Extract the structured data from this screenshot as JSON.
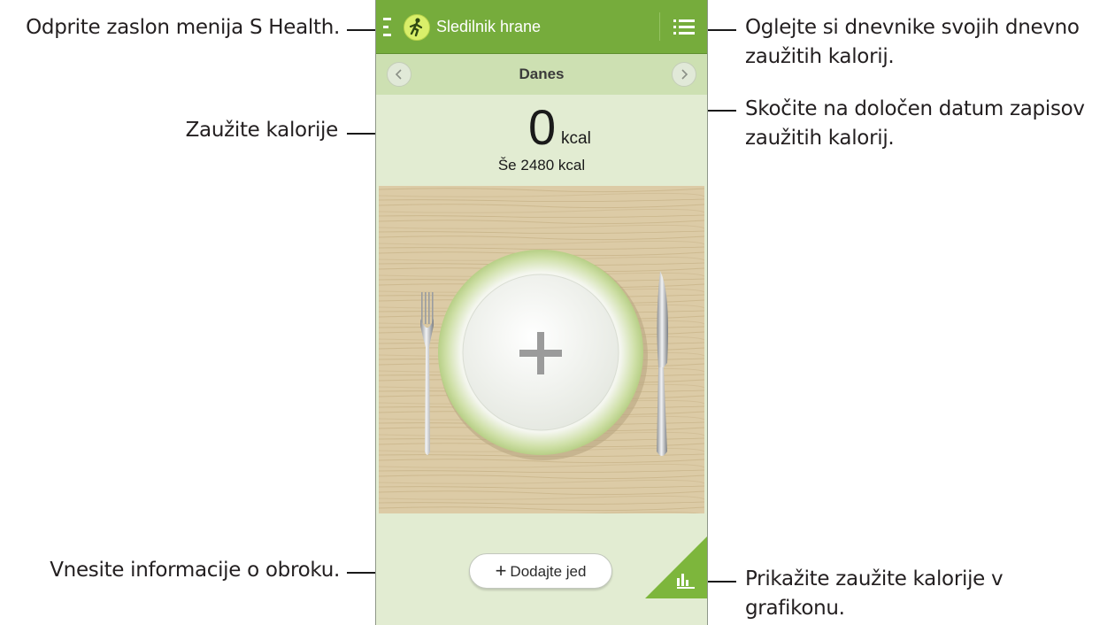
{
  "app": {
    "title": "Sledilnik hrane"
  },
  "datebar": {
    "label": "Danes"
  },
  "calories": {
    "value": "0",
    "unit": "kcal",
    "remaining": "Še 2480 kcal"
  },
  "actions": {
    "add_meal_plus": "+",
    "add_meal_label": "Dodajte jed"
  },
  "callouts": {
    "menu": "Odprite zaslon menija S Health.",
    "consumed": "Zaužite kalorije",
    "meal_info": "Vnesite informacije o obroku.",
    "logs_line1": "Oglejte si dnevnike svojih dnevno",
    "logs_line2": "zaužitih kalorij.",
    "date_line1": "Skočite na določen datum zapisov",
    "date_line2": "zaužitih kalorij.",
    "graph_line1": "Prikažite zaužite kalorije v",
    "graph_line2": "grafikonu."
  },
  "colors": {
    "actionbar": "#76ac3c",
    "datebar": "#cde0b2",
    "background": "#e2ecd2",
    "accent": "#7db63c",
    "table": "#d9c8a4"
  },
  "icons": {
    "menu": "menu-icon",
    "logo": "runner-logo-icon",
    "logs": "list-icon",
    "prev": "chevron-left-icon",
    "next": "chevron-right-icon",
    "plate": "plus-icon",
    "graph": "bar-chart-icon"
  }
}
